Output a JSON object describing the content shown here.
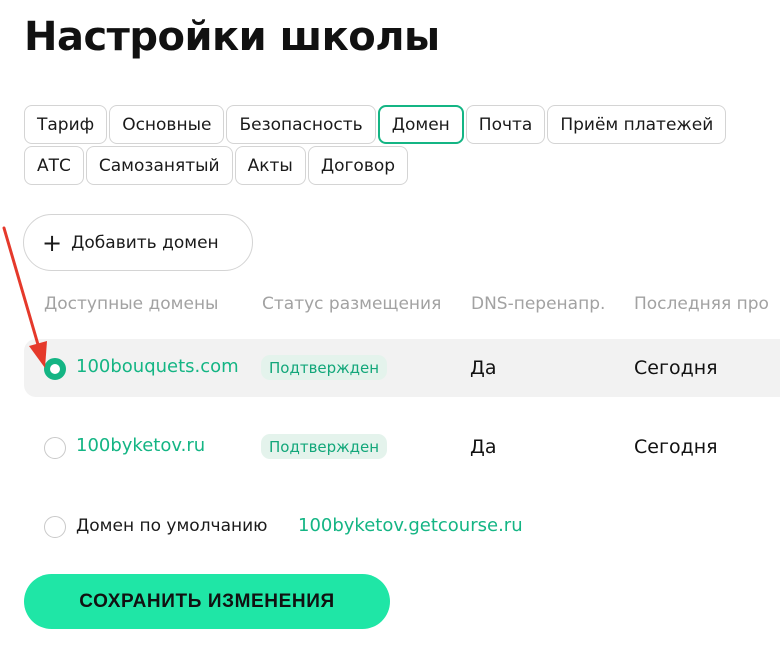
{
  "page": {
    "title": "Настройки школы"
  },
  "tabs": {
    "row1": [
      "Тариф",
      "Основные",
      "Безопасность",
      "Домен",
      "Почта",
      "Приём платежей"
    ],
    "row2": [
      "АТС",
      "Самозанятый",
      "Акты",
      "Договор"
    ],
    "active": "Домен"
  },
  "add_domain": {
    "label": "Добавить домен"
  },
  "table": {
    "headers": [
      "Доступные домены",
      "Статус размещения",
      "DNS-перенапр.",
      "Последняя про"
    ],
    "rows": [
      {
        "domain": "100bouquets.com",
        "status": "Подтвержден",
        "dns": "Да",
        "last": "Сегодня",
        "selected": true
      },
      {
        "domain": "100byketov.ru",
        "status": "Подтвержден",
        "dns": "Да",
        "last": "Сегодня",
        "selected": false
      }
    ]
  },
  "default_domain": {
    "label": "Домен по умолчанию",
    "value": "100byketov.getcourse.ru",
    "selected": false
  },
  "save_button": {
    "label": "СОХРАНИТЬ ИЗМЕНЕНИЯ"
  },
  "colors": {
    "accent": "#14b584",
    "save_button_bg": "#1fe6a6",
    "badge_bg": "#e4f3ec",
    "arrow": "#e5392b"
  }
}
